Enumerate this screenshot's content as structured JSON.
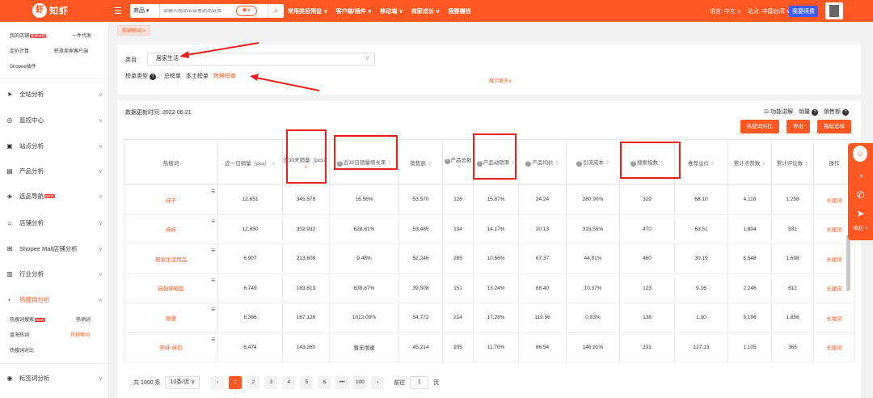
{
  "topbar": {
    "logo_text": "知虾",
    "search_category": "商品",
    "search_placeholder": "请输入商品ID或者商品链接",
    "nav": [
      "常用类目预设 ∨",
      "客户端/插件 ∨",
      "移动端 ∨",
      "商家成长 ∨",
      "我要赚钱"
    ],
    "language": "语言: 中文 ∨",
    "site": "站点: 中国台湾 ∨",
    "renew": "我要续费"
  },
  "sidebar": {
    "quick_links": [
      "我的店铺",
      "一件代发",
      "定价计算",
      "虾皮卖家客户端",
      "Shopee插件"
    ],
    "quick_badge": "免费试用",
    "items": [
      {
        "label": "全站分析",
        "icon": "send-icon"
      },
      {
        "label": "监控中心",
        "icon": "monitor-icon"
      },
      {
        "label": "站点分析",
        "icon": "site-icon"
      },
      {
        "label": "产品分析",
        "icon": "product-icon"
      },
      {
        "label": "选品导航",
        "icon": "compass-icon",
        "badge": "NEW"
      },
      {
        "label": "店铺分析",
        "icon": "shop-icon"
      },
      {
        "label": "Shopee Mall店铺分析",
        "icon": "mall-icon"
      },
      {
        "label": "行业分析",
        "icon": "industry-icon"
      },
      {
        "label": "热搜词分析",
        "icon": "hot-icon"
      },
      {
        "label": "标签词分析",
        "icon": "tag-icon"
      }
    ],
    "subitems": [
      "热搜词搜索",
      "热销词",
      "蓝海热词",
      "热销榜词",
      "热搜词对比"
    ],
    "sub_badge": "NEW"
  },
  "tag": "热销新词 ×",
  "filter": {
    "category_label": "类目:",
    "category_value": "居家生活",
    "rank_type_label": "榜单类型",
    "rank_types": [
      "总榜单",
      "本土榜单",
      "跨境榜单"
    ],
    "show_more": "展示更多∨"
  },
  "main": {
    "update_label": "数据更新时间: 2022-06-21",
    "tools": [
      "功能讲解",
      "销量",
      "销售额"
    ],
    "buttons": [
      "热搜词对比",
      "导出",
      "指标选择"
    ]
  },
  "table": {
    "headers": [
      "热搜词",
      "近一日销量（pcs）",
      "近30天销量（pcs）",
      "近30日销量增长率",
      "销售额",
      "产品总数",
      "产品动销率",
      "产品均价",
      "引流成本",
      "搜索指数",
      "推荐出价",
      "累计点赞数",
      "累计评论数",
      "操作"
    ],
    "rows": [
      [
        "袜子",
        "12,651",
        "345,578",
        "16.56%",
        "53,570",
        "126",
        "15.87%",
        "24.24",
        "280.90%",
        "329",
        "68.10",
        "4,118",
        "1,258",
        "长尾词"
      ],
      [
        "袜袜",
        "12,650",
        "332,932",
        "628.61%",
        "53,485",
        "134",
        "14.17%",
        "20.13",
        "315.55%",
        "470",
        "63.51",
        "1,804",
        "531",
        "长尾词"
      ],
      [
        "居家生活用品",
        "6,907",
        "213,609",
        "9.48%",
        "52,246",
        "285",
        "10.56%",
        "67.37",
        "44.81%",
        "460",
        "30.19",
        "6,548",
        "1,698",
        "长尾词"
      ],
      [
        "自黏伸缩型",
        "6,749",
        "183,813",
        "838.87%",
        "39,508",
        "151",
        "13.24%",
        "88.40",
        "10.37%",
        "123",
        "9.16",
        "2,246",
        "612",
        "长尾词"
      ],
      [
        "眼罩",
        "6,386",
        "167,126",
        "1012.09%",
        "54,772",
        "214",
        "17.28%",
        "119.96",
        "0.83%",
        "138",
        "1.00",
        "5,196",
        "1,856",
        "长尾词"
      ],
      [
        "熟袜·袜包",
        "6,474",
        "143,260",
        "暂无增速",
        "45,214",
        "205",
        "11.70%",
        "86.54",
        "146.91%",
        "231",
        "127.13",
        "1,105",
        "365",
        "长尾词"
      ]
    ]
  },
  "pager": {
    "total": "共 1000 条",
    "size": "10条/页 ∨",
    "pages": [
      "1",
      "2",
      "3",
      "4",
      "5",
      "6",
      "•••",
      "100"
    ],
    "goto_label": "前往",
    "goto_value": "1",
    "page_unit": "页"
  },
  "float_bar": {
    "label": "收起 >"
  },
  "colors": {
    "accent": "#ff5722",
    "annotation": "#e8201c"
  }
}
